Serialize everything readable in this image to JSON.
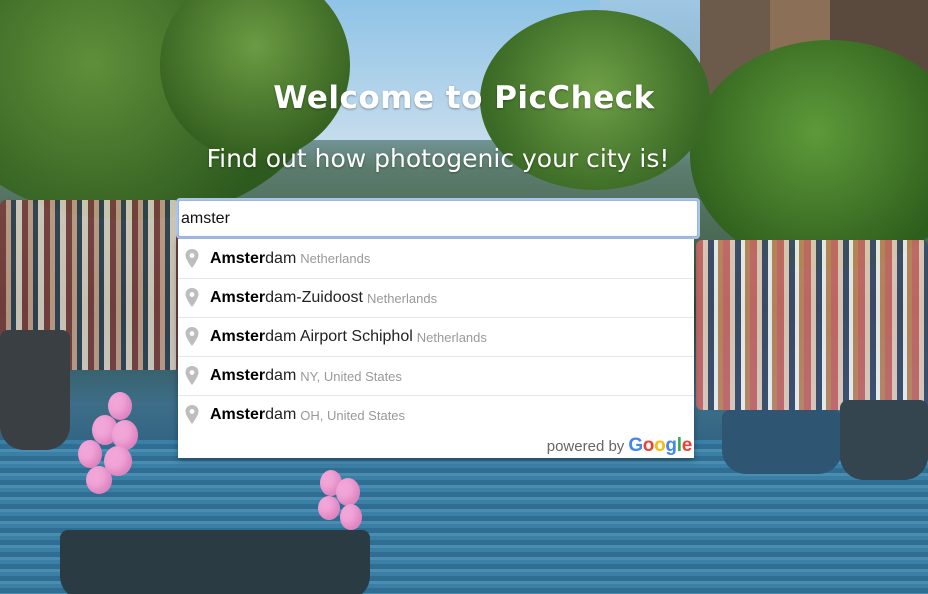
{
  "hero": {
    "title": "Welcome to PicCheck",
    "subtitle": "Find out how photogenic your city is!"
  },
  "search": {
    "value": "amster",
    "placeholder": ""
  },
  "suggestions": [
    {
      "match": "Amster",
      "rest": "dam",
      "secondary": "Netherlands",
      "icon": "location-pin-icon"
    },
    {
      "match": "Amster",
      "rest": "dam-Zuidoost",
      "secondary": "Netherlands",
      "icon": "location-pin-icon"
    },
    {
      "match": "Amster",
      "rest": "dam Airport Schiphol",
      "secondary": "Netherlands",
      "icon": "location-pin-icon"
    },
    {
      "match": "Amster",
      "rest": "dam",
      "secondary": "NY, United States",
      "icon": "location-pin-icon"
    },
    {
      "match": "Amster",
      "rest": "dam",
      "secondary": "OH, United States",
      "icon": "location-pin-icon"
    }
  ],
  "attribution": {
    "powered_by": "powered by",
    "logo_letters": [
      "G",
      "o",
      "o",
      "g",
      "l",
      "e"
    ],
    "logo_colors": [
      "#4285F4",
      "#EA4335",
      "#FBBC05",
      "#4285F4",
      "#34A853",
      "#EA4335"
    ]
  },
  "background": {
    "description_colors": {
      "sky": "#9ec7e4",
      "water": "#2a5f80",
      "foliage": "#3b6a2e",
      "balloons": "#f2a6d8"
    }
  }
}
